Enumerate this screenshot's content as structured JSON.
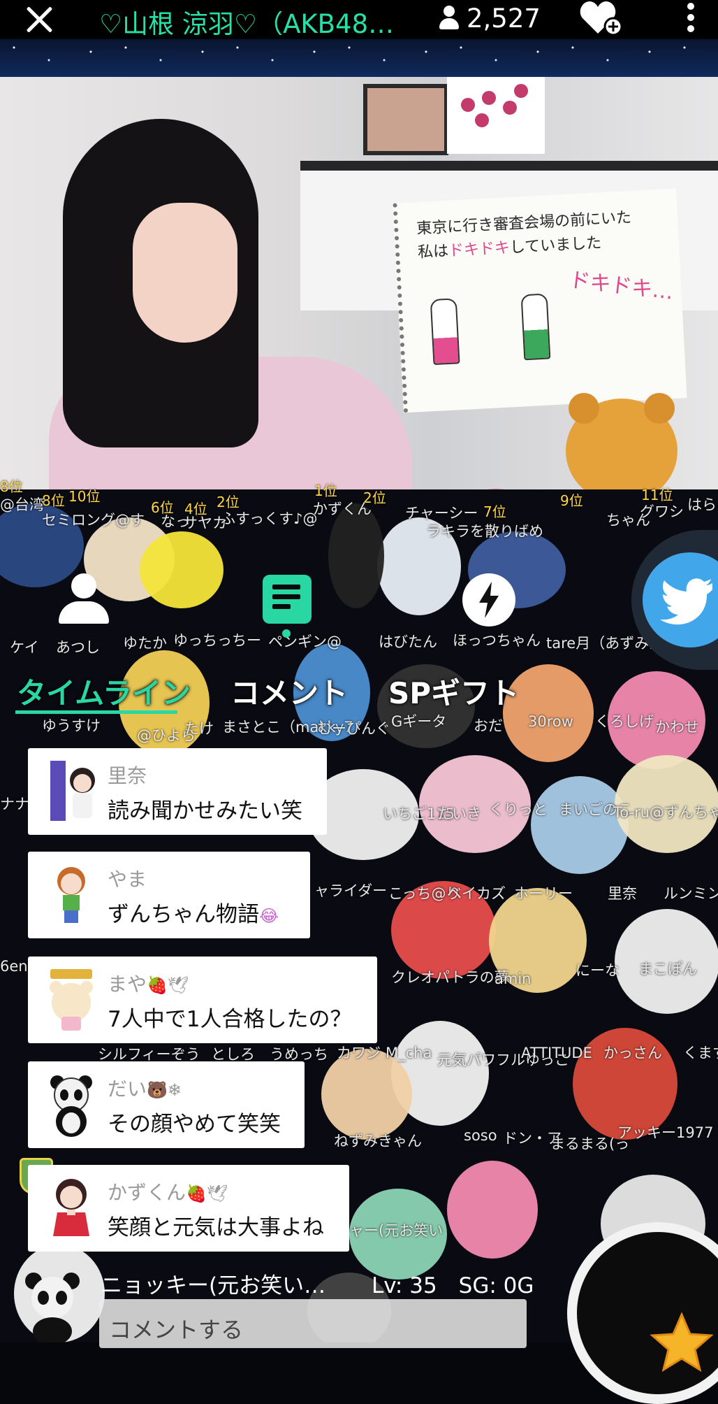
{
  "header": {
    "title": "♡山根 涼羽♡（AKB48…",
    "viewer_count": "2,527",
    "accent_color": "#27e0a8"
  },
  "video": {
    "board_line1": "東京に行き審査会場の前にいた",
    "board_line2_a": "私は",
    "board_line2_b": "ドキドキ",
    "board_line2_c": "していました",
    "board_doki": "ドキドキ…"
  },
  "ranks": [
    "8位",
    "10位",
    "6位",
    "4位",
    "2位",
    "1位",
    "2位",
    "7位",
    "9位",
    "11位"
  ],
  "fan_names": [
    "@台湾",
    "セミロング@す",
    "なっ",
    "サヤカ",
    "ふすっくす♪@",
    "かずくん",
    "チャーシー",
    "ラキラを散りばめ",
    "ちゃん",
    "グワシ",
    "はら",
    "ケイ",
    "あつし",
    "ゆたか",
    "ゆっちっちー",
    "ペンギン@",
    "はびたん",
    "ほっつちゃん",
    "tare月（あずみん",
    "ゆうすけ",
    "@ひよら",
    "たけ",
    "まさとこ（makky7",
    "むーぴんぐ",
    "Gギータ",
    "おだ",
    "30row",
    "くろしげ",
    "かわせ",
    "いちご115",
    "たいき",
    "くりっと",
    "まいごのこ",
    "To-ru@ずんちゃ",
    "ナナ",
    "ャライダー",
    "こっち@り",
    "ベイカズ",
    "ホーリー",
    "里奈",
    "ルンミン",
    "6en",
    "クレオパトラの夢",
    "amin",
    "にーな",
    "まこぽん",
    "シルフィーぞう",
    "としろ",
    "うめっち",
    "カワジ",
    "M_cha",
    "元気パワフルゆっこ",
    "ATTITUDE",
    "かっさん",
    "くます",
    "ねずみきゃん",
    "soso",
    "ドン・ア",
    "まるまる(っ",
    "アッキー1977",
    "ャー(元お笑い"
  ],
  "nav": {
    "tabs": [
      {
        "label": "タイムライン"
      },
      {
        "label": "コメント"
      },
      {
        "label": "SPギフト"
      }
    ]
  },
  "comments": [
    {
      "name": "里奈",
      "text": "読み聞かせみたい笑",
      "name_suffix": ""
    },
    {
      "name": "やま",
      "text": "ずんちゃん物語",
      "text_suffix": "😂"
    },
    {
      "name": "まや",
      "name_suffix": "🍓🕊",
      "text": "7人中で1人合格したの？"
    },
    {
      "name": "だい",
      "name_suffix": "🐻❄",
      "text": "その顔やめて笑笑"
    },
    {
      "name": "かずくん",
      "name_suffix": "🍓🕊",
      "text": "笑顔と元気は大事よね"
    }
  ],
  "bottom": {
    "username": "ニョッキー(元お笑い…",
    "level": "Lv: 35　SG:  0G",
    "input_placeholder": "コメントする"
  }
}
